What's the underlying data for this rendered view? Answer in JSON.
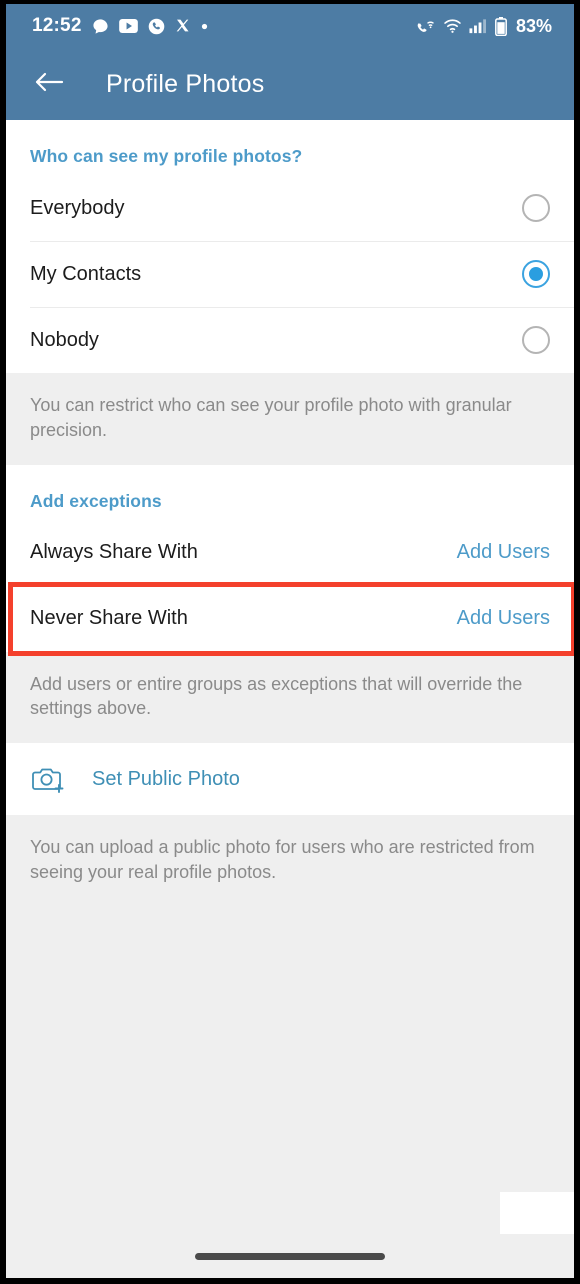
{
  "statusbar": {
    "time": "12:52",
    "battery_percent": "83%",
    "left_icons": [
      "chat-bubble-icon",
      "youtube-icon",
      "phone-circle-icon",
      "x-twitter-icon",
      "dot-icon"
    ],
    "right_icons": [
      "call-wifi-icon",
      "wifi-icon",
      "signal-bars-icon",
      "battery-icon"
    ]
  },
  "appbar": {
    "back_icon": "arrow-left-icon",
    "title": "Profile Photos"
  },
  "visibility": {
    "section_title": "Who can see my profile photos?",
    "options": [
      {
        "label": "Everybody",
        "selected": false
      },
      {
        "label": "My Contacts",
        "selected": true
      },
      {
        "label": "Nobody",
        "selected": false
      }
    ],
    "description": "You can restrict who can see your profile photo with granular precision."
  },
  "exceptions": {
    "section_title": "Add exceptions",
    "rows": [
      {
        "label": "Always Share With",
        "action": "Add Users",
        "highlighted": false
      },
      {
        "label": "Never Share With",
        "action": "Add Users",
        "highlighted": true
      }
    ],
    "description": "Add users or entire groups as exceptions that will override the settings above."
  },
  "public_photo": {
    "icon": "camera-add-icon",
    "label": "Set Public Photo",
    "description": "You can upload a public photo for users who are restricted from seeing your real profile photos."
  },
  "navbar": {
    "gesture_handle": "home-gesture-bar"
  },
  "colors": {
    "header_blue": "#4d7ca4",
    "accent_blue": "#4d9bc9",
    "link_blue": "#4d9bc9",
    "highlight_red": "#f4402c",
    "band_gray": "#efefef",
    "muted_text": "#8a8a8a"
  }
}
